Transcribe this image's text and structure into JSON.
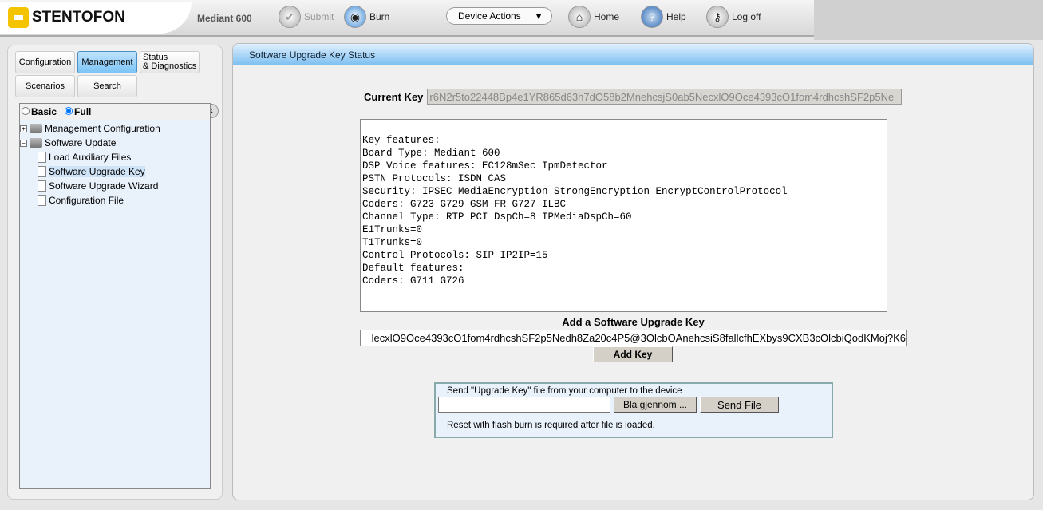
{
  "header": {
    "brand": "STENTOFON",
    "device": "Mediant 600",
    "submit": "Submit",
    "burn": "Burn",
    "device_actions": "Device Actions",
    "home": "Home",
    "help": "Help",
    "logoff": "Log off"
  },
  "nav": {
    "configuration": "Configuration",
    "management": "Management",
    "status1": "Status",
    "status2": "& Diagnostics",
    "scenarios": "Scenarios",
    "search": "Search"
  },
  "view": {
    "basic": "Basic",
    "full": "Full"
  },
  "tree": [
    "Management Configuration",
    "Software Update",
    "Load Auxiliary Files",
    "Software Upgrade Key",
    "Software Upgrade Wizard",
    "Configuration File"
  ],
  "main": {
    "title": "Software Upgrade Key Status",
    "current_key_label": "Current Key",
    "current_key": "r6N2r5to22448Bp4e1YR865d63h7dO58b2MnehcsjS0ab5NecxlO9Oce4393cO1fom4rdhcshSF2p5Ne",
    "features": "Key features:\nBoard Type: Mediant 600\nDSP Voice features: EC128mSec IpmDetector\nPSTN Protocols: ISDN CAS\nSecurity: IPSEC MediaEncryption StrongEncryption EncryptControlProtocol\nCoders: G723 G729 GSM-FR G727 ILBC\nChannel Type: RTP PCI DspCh=8 IPMediaDspCh=60\nE1Trunks=0\nT1Trunks=0\nControl Protocols: SIP IP2IP=15\nDefault features:\nCoders: G711 G726",
    "add_label": "Add a Software Upgrade Key",
    "add_value": "lecxlO9Oce4393cO1fom4rdhcshSF2p5Nedh8Za20c4P5@3OlcbOAnehcsiS8fallcfhEXbys9CXB3cOlcbiQodKMoj?K6",
    "add_button": "Add Key",
    "send_title": "Send \"Upgrade Key\" file from your computer to the device",
    "browse": "Bla gjennom ...",
    "send_file": "Send File",
    "note": "Reset with flash burn is required after file is loaded."
  }
}
